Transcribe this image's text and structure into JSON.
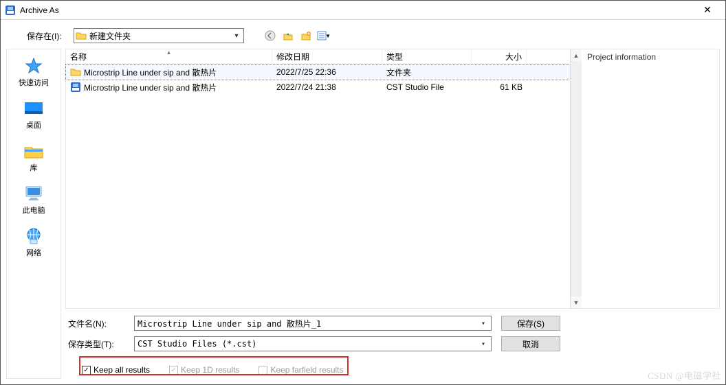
{
  "window": {
    "title": "Archive As"
  },
  "toolbar": {
    "save_in_label": "保存在(I):",
    "save_in_value": "新建文件夹"
  },
  "places": [
    {
      "label": "快速访问"
    },
    {
      "label": "桌面"
    },
    {
      "label": "库"
    },
    {
      "label": "此电脑"
    },
    {
      "label": "网络"
    }
  ],
  "columns": {
    "name": "名称",
    "date": "修改日期",
    "type": "类型",
    "size": "大小"
  },
  "rows": [
    {
      "icon": "folder",
      "name": "Microstrip Line under sip and 散热片",
      "date": "2022/7/25 22:36",
      "type": "文件夹",
      "size": "",
      "selected": true
    },
    {
      "icon": "cst",
      "name": "Microstrip Line under sip and 散热片",
      "date": "2022/7/24 21:38",
      "type": "CST Studio File",
      "size": "61 KB",
      "selected": false
    }
  ],
  "info_panel": {
    "title": "Project information"
  },
  "fields": {
    "filename_label": "文件名(N):",
    "filename_value": "Microstrip Line under sip and 散热片_1",
    "filetype_label": "保存类型(T):",
    "filetype_value": "CST Studio Files (*.cst)"
  },
  "buttons": {
    "save": "保存(S)",
    "cancel": "取消"
  },
  "checks": {
    "keep_all": {
      "label": "Keep all results",
      "checked": true,
      "enabled": true
    },
    "keep_1d": {
      "label": "Keep 1D results",
      "checked": true,
      "enabled": false
    },
    "keep_far": {
      "label": "Keep farfield results",
      "checked": false,
      "enabled": false
    }
  },
  "watermark": "CSDN @电磁学社"
}
